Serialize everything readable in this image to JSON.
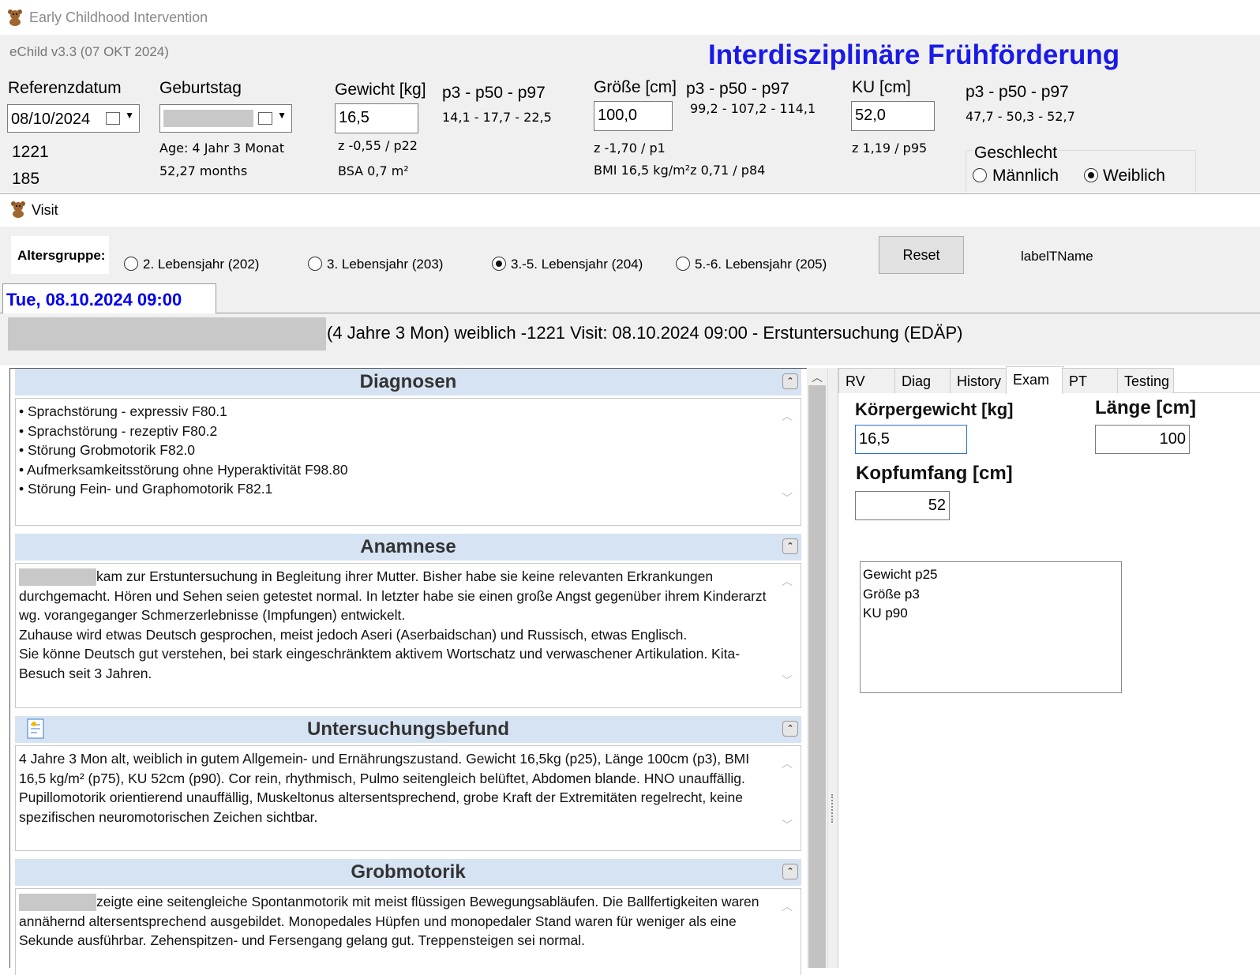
{
  "app": {
    "title": "Early Childhood Intervention",
    "version": "eChild v3.3 (07 OKT 2024)",
    "banner": "Interdisziplinäre Frühförderung"
  },
  "colors": {
    "banner": "#1a1ae6",
    "date_tab": "#0000ee",
    "section_header_bg": "#d6e3f2",
    "panel_bg": "#f0f0f0"
  },
  "top": {
    "ref_label": "Referenzdatum",
    "ref_value": "08/10/2024",
    "id1": "1221",
    "id2": "185",
    "birth_label": "Geburtstag",
    "age": "Age: 4 Jahr 3 Monat",
    "months": "52,27 months",
    "weight_label": "Gewicht [kg]",
    "weight_value": "16,5",
    "weight_z": "z -0,55 / p22",
    "bsa": "BSA 0,7 m²",
    "weight_perc_label": "p3 - p50 - p97",
    "weight_perc": "14,1 - 17,7 - 22,5",
    "height_label": "Größe [cm]",
    "height_value": "100,0",
    "height_z": "z -1,70 / p1",
    "bmi": "BMI 16,5 kg/m²z 0,71 / p84",
    "height_perc_label": "p3 - p50 - p97",
    "height_perc": "99,2 - 107,2 - 114,1",
    "ku_label": "KU [cm]",
    "ku_value": "52,0",
    "ku_z": "z 1,19 / p95",
    "ku_perc_label": "p3 - p50 - p97",
    "ku_perc": "47,7 - 50,3 - 52,7",
    "sex_label": "Geschlecht",
    "sex_male": "Männlich",
    "sex_female": "Weiblich",
    "sex_selected": "Weiblich"
  },
  "visit": {
    "window_title": "Visit",
    "age_group_label": "Altersgruppe:",
    "age_groups": [
      "2. Lebensjahr (202)",
      "3. Lebensjahr (203)",
      "3.-5. Lebensjahr (204)",
      "5.-6. Lebensjahr (205)"
    ],
    "age_group_selected": "3.-5. Lebensjahr (204)",
    "reset": "Reset",
    "label_tname": "labelTName",
    "date_tab": "Tue, 08.10.2024 09:00",
    "header": "(4 Jahre 3 Mon) weiblich -1221  Visit: 08.10.2024 09:00 - Erstuntersuchung (EDÄP)"
  },
  "sections": {
    "diag_title": "Diagnosen",
    "diag_items": [
      "• Sprachstörung - expressiv  F80.1",
      "• Sprachstörung - rezeptiv  F80.2",
      "• Störung Grobmotorik  F82.0",
      "• Aufmerksamkeitsstörung ohne Hyperaktivität  F98.80",
      "• Störung Fein- und Graphomotorik  F82.1"
    ],
    "anam_title": "Anamnese",
    "anam_first": "kam zur Erstuntersuchung in Begleitung ihrer Mutter. Bisher habe sie keine relevanten Erkrankungen",
    "anam_rest": "durchgemacht. Hören und Sehen seien getestet normal. In letzter habe sie einen große Angst gegenüber ihrem Kinderarzt wg. vorangeganger Schmerzerlebnisse (Impfungen) entwickelt.\nZuhause wird etwas Deutsch gesprochen, meist jedoch Aseri (Aserbaidschan) und Russisch, etwas Englisch.\nSie könne Deutsch gut verstehen, bei stark eingeschränktem aktivem Wortschatz und verwaschener Artikulation. Kita-Besuch seit 3 Jahren.",
    "befund_title": "Untersuchungsbefund",
    "befund_text": "4 Jahre 3 Mon alt, weiblich in gutem Allgemein- und Ernährungszustand. Gewicht 16,5kg (p25), Länge 100cm (p3), BMI 16,5 kg/m² (p75), KU 52cm (p90). Cor rein, rhythmisch, Pulmo seitengleich belüftet, Abdomen blande. HNO unauffällig. Pupillomotorik orientierend unauffällig, Muskeltonus altersentsprechend, grobe Kraft der Extremitäten regelrecht, keine spezifischen neuromotorischen Zeichen sichtbar.",
    "grob_title": "Grobmotorik",
    "grob_first": "zeigte eine seitengleiche Spontanmotorik mit meist flüssigen Bewegungsabläufen. Die Ballfertigkeiten waren",
    "grob_rest": "annähernd altersentsprechend ausgebildet. Monopedales Hüpfen und monopedaler Stand waren für weniger als eine Sekunde ausführbar. Zehenspitzen- und Fersengang gelang gut. Treppensteigen sei normal."
  },
  "right": {
    "tabs": [
      "RV",
      "Diag",
      "History",
      "Exam",
      "PT",
      "Testing"
    ],
    "active_tab": "Exam",
    "kg_label": "Körpergewicht [kg]",
    "kg_value": "16,5",
    "len_label": "Länge [cm]",
    "len_value": "100",
    "kopf_label": "Kopfumfang [cm]",
    "kopf_value": "52",
    "list": [
      "Gewicht p25",
      "Größe p3",
      "KU p90"
    ]
  }
}
